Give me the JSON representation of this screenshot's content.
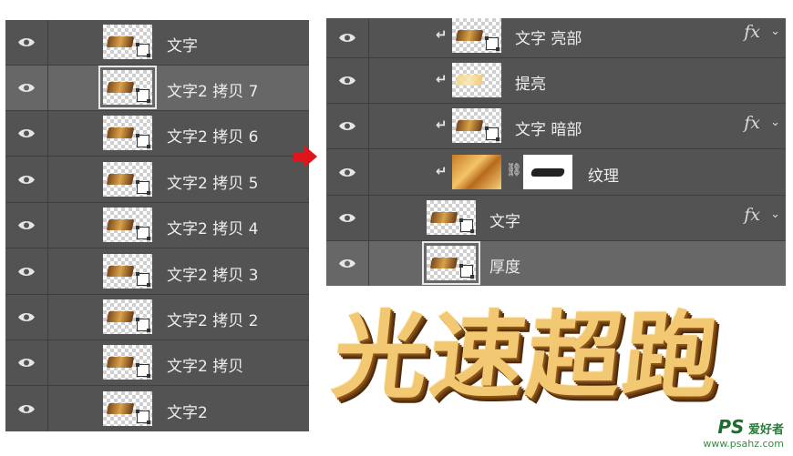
{
  "left_panel": {
    "layers": [
      {
        "name": "文字",
        "selected": false
      },
      {
        "name": "文字2 拷贝 7",
        "selected": true
      },
      {
        "name": "文字2 拷贝 6",
        "selected": false
      },
      {
        "name": "文字2 拷贝 5",
        "selected": false
      },
      {
        "name": "文字2 拷贝 4",
        "selected": false
      },
      {
        "name": "文字2 拷贝 3",
        "selected": false
      },
      {
        "name": "文字2 拷贝 2",
        "selected": false
      },
      {
        "name": "文字2 拷贝",
        "selected": false
      },
      {
        "name": "文字2",
        "selected": false
      }
    ]
  },
  "right_panel": {
    "layers": [
      {
        "name": "文字 亮部",
        "clipped": true,
        "fx": "fx",
        "selected": false
      },
      {
        "name": "提亮",
        "clipped": true,
        "fx": "",
        "selected": false
      },
      {
        "name": "文字 暗部",
        "clipped": true,
        "fx": "fx",
        "selected": false
      },
      {
        "name": "纹理",
        "clipped": true,
        "fx": "",
        "has_mask": true,
        "selected": false
      },
      {
        "name": "文字",
        "clipped": false,
        "fx": "fx",
        "selected": false
      },
      {
        "name": "厚度",
        "clipped": false,
        "fx": "",
        "selected": true
      }
    ]
  },
  "artwork": {
    "title": "光速超跑"
  },
  "watermark": {
    "brand": "PS",
    "cn": "爱好者",
    "url": "www.psahz.com"
  },
  "colors": {
    "panel_bg": "#535353",
    "selected_bg": "#676767",
    "arrow": "#e0141b",
    "gold": "#f2c873"
  },
  "icons": {
    "visibility": "eye-icon",
    "clip": "clipping-arrow-icon",
    "link": "chain-link-icon",
    "expand": "chevron-down-icon",
    "pointer": "red-arrow-icon"
  }
}
